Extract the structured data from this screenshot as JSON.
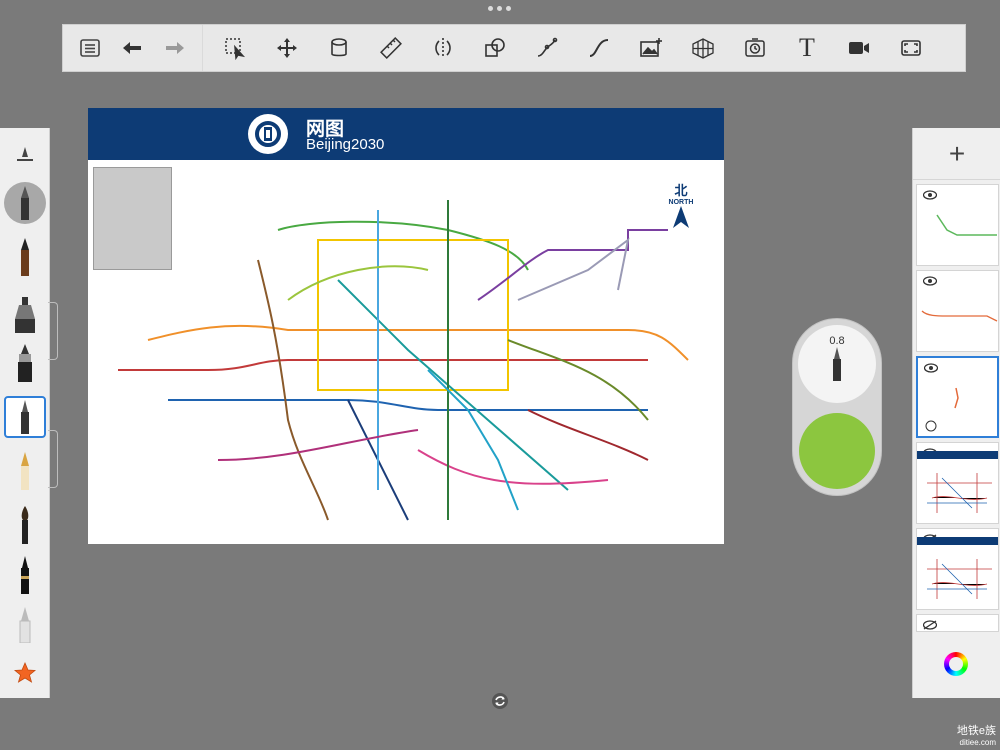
{
  "toolbar": {
    "left_buttons": [
      "list-icon",
      "undo-icon",
      "redo-icon"
    ],
    "tools": [
      "selection-icon",
      "transform-icon",
      "fill-bucket-icon",
      "ruler-icon",
      "symmetry-icon",
      "shape-icon",
      "curve-icon",
      "stroke-icon",
      "import-image-icon",
      "perspective-grid-icon",
      "time-lapse-icon",
      "text-tool-icon",
      "record-icon",
      "fullscreen-icon"
    ],
    "text_tool_label": "T"
  },
  "brush_panel": {
    "brushes": [
      "brush-settings-icon",
      "pencil-icon",
      "marker-icon",
      "ink-pen-icon",
      "technical-pen-icon",
      "fountain-pen-icon",
      "paint-brush-icon",
      "brush-pen-icon",
      "eraser-icon",
      "favorites-star-icon"
    ],
    "selected": "technical-pen-icon"
  },
  "canvas": {
    "map_title": "网图",
    "map_subtitle": "Beijing2030",
    "north_zh": "北",
    "north_en": "NORTH",
    "header_color": "#0d3b75"
  },
  "brush_controls": {
    "size_value": "0.8",
    "current_color": "#8cc63f"
  },
  "layers_panel": {
    "add_label": "+",
    "layers": [
      {
        "name": "layer-1",
        "visible": true
      },
      {
        "name": "layer-2",
        "visible": true
      },
      {
        "name": "layer-3",
        "visible": true,
        "selected": true
      },
      {
        "name": "layer-4",
        "visible": true
      },
      {
        "name": "layer-5",
        "visible": false
      },
      {
        "name": "layer-6",
        "visible": false
      }
    ]
  },
  "watermark": {
    "line1": "地铁e族",
    "line2": "ditiee.com"
  }
}
